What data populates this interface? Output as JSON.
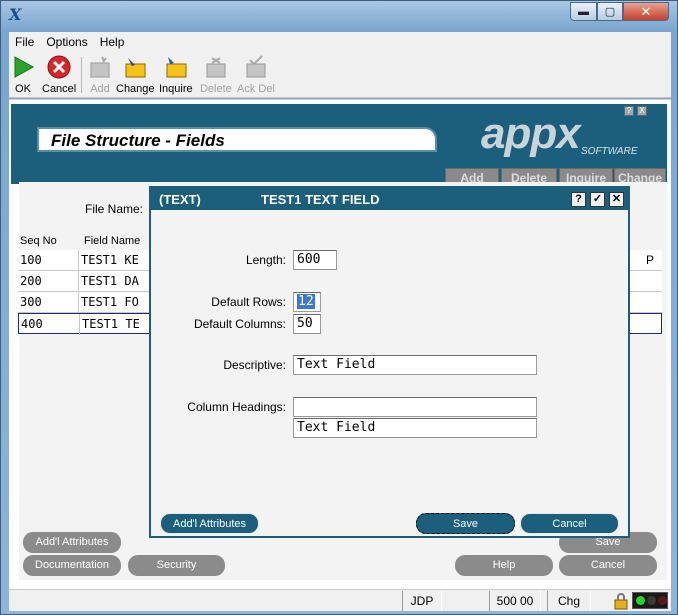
{
  "window": {
    "app_glyph": "X",
    "controls": {
      "minimize": "▬",
      "maximize": "▢",
      "close": "✕"
    }
  },
  "menu": [
    "File",
    "Options",
    "Help"
  ],
  "toolbar": {
    "ok": "OK",
    "cancel": "Cancel",
    "add": "Add",
    "change": "Change",
    "inquire": "Inquire",
    "delete": "Delete",
    "ack_del": "Ack Del"
  },
  "panel": {
    "title": "File Structure - Fields",
    "logo_main": "appx",
    "logo_sub": "SOFTWARE",
    "mini_icons": [
      "?",
      "X"
    ],
    "tabs": [
      "Add",
      "Delete",
      "Inquire",
      "Change"
    ]
  },
  "background": {
    "file_name_label": "File Name:",
    "headers": {
      "seq_no": "Seq No",
      "field_name": "Field Name"
    },
    "rows": [
      {
        "seq": "100",
        "field": "TEST1 KE",
        "p": "P"
      },
      {
        "seq": "200",
        "field": "TEST1 DA",
        "p": ""
      },
      {
        "seq": "300",
        "field": "TEST1 FO",
        "p": ""
      },
      {
        "seq": "400",
        "field": "TEST1 TE",
        "p": ""
      }
    ],
    "buttons": {
      "addl_attributes": "Add'l Attributes",
      "documentation": "Documentation",
      "security": "Security",
      "save": "Save",
      "help": "Help",
      "cancel": "Cancel"
    }
  },
  "status": {
    "user": "JDP",
    "amount": "500 00",
    "mode": "Chg"
  },
  "dialog": {
    "type": "(TEXT)",
    "title": "TEST1 TEXT FIELD",
    "controls": {
      "help": "?",
      "ok": "✓",
      "close": "✕"
    },
    "fields": {
      "length_label": "Length:",
      "length_value": "600",
      "default_rows_label": "Default Rows:",
      "default_rows_value": "12",
      "default_columns_label": "Default Columns:",
      "default_columns_value": "50",
      "descriptive_label": "Descriptive:",
      "descriptive_value": "Text Field",
      "column_headings_label": "Column Headings:",
      "column_heading_1": "",
      "column_heading_2": "Text Field"
    },
    "buttons": {
      "addl_attributes": "Add'l Attributes",
      "save": "Save",
      "cancel": "Cancel"
    }
  }
}
